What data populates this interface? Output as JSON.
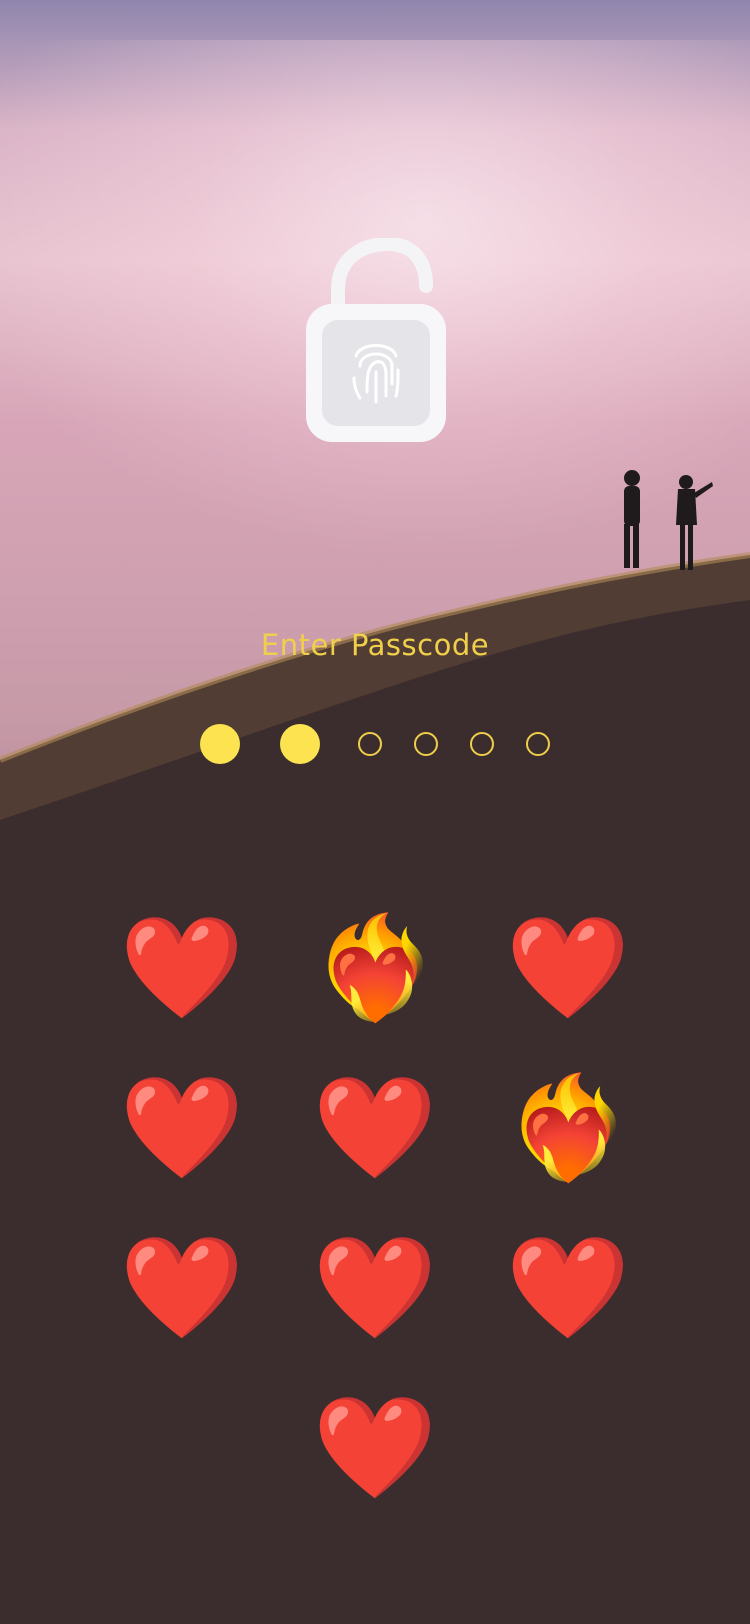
{
  "lock": {
    "icon": "fingerprint-padlock-icon",
    "state": "unlocked"
  },
  "prompt": {
    "title": "Enter Passcode"
  },
  "passcode": {
    "total": 6,
    "filled": 2,
    "accent": "#fde34f"
  },
  "keypad": {
    "keys": [
      {
        "label": "❤️",
        "icon": "red-heart-icon"
      },
      {
        "label": "❤️‍🔥",
        "icon": "heart-on-fire-icon"
      },
      {
        "label": "❤️",
        "icon": "red-heart-icon"
      },
      {
        "label": "❤️",
        "icon": "red-heart-icon"
      },
      {
        "label": "❤️",
        "icon": "red-heart-icon"
      },
      {
        "label": "❤️‍🔥",
        "icon": "heart-on-fire-icon"
      },
      {
        "label": "❤️",
        "icon": "red-heart-icon"
      },
      {
        "label": "❤️",
        "icon": "red-heart-icon"
      },
      {
        "label": "❤️",
        "icon": "red-heart-icon"
      },
      {
        "label": "❤️",
        "icon": "red-heart-icon"
      }
    ]
  }
}
